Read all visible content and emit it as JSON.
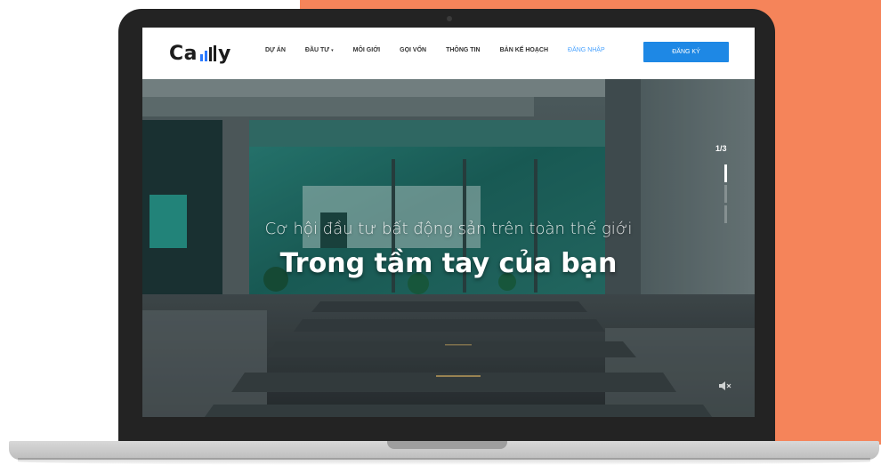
{
  "site": {
    "logo_text_left": "Ca",
    "logo_text_right": "y",
    "logo_mark": "bar-chart-logo-mark"
  },
  "nav": {
    "items": [
      {
        "label": "DỰ ÁN"
      },
      {
        "label": "ĐẦU TƯ",
        "has_dropdown": true
      },
      {
        "label": "MÔI GIỚI"
      },
      {
        "label": "GỌI VỐN"
      },
      {
        "label": "THÔNG TIN"
      },
      {
        "label": "BẢN KẾ HOẠCH"
      }
    ],
    "login_label": "ĐĂNG NHẬP",
    "register_label": "ĐĂNG KÝ"
  },
  "hero": {
    "subtitle": "Cơ hội đầu tư bất động sản trên toàn thế giới",
    "title": "Trong tầm tay của bạn",
    "slide_counter": "1/3",
    "slide_total": 3,
    "slide_current": 1,
    "mute_icon": "speaker-muted-icon"
  },
  "colors": {
    "accent_blue": "#1E88E5",
    "background_orange": "#F5845A",
    "laptop_bezel": "#232323"
  }
}
